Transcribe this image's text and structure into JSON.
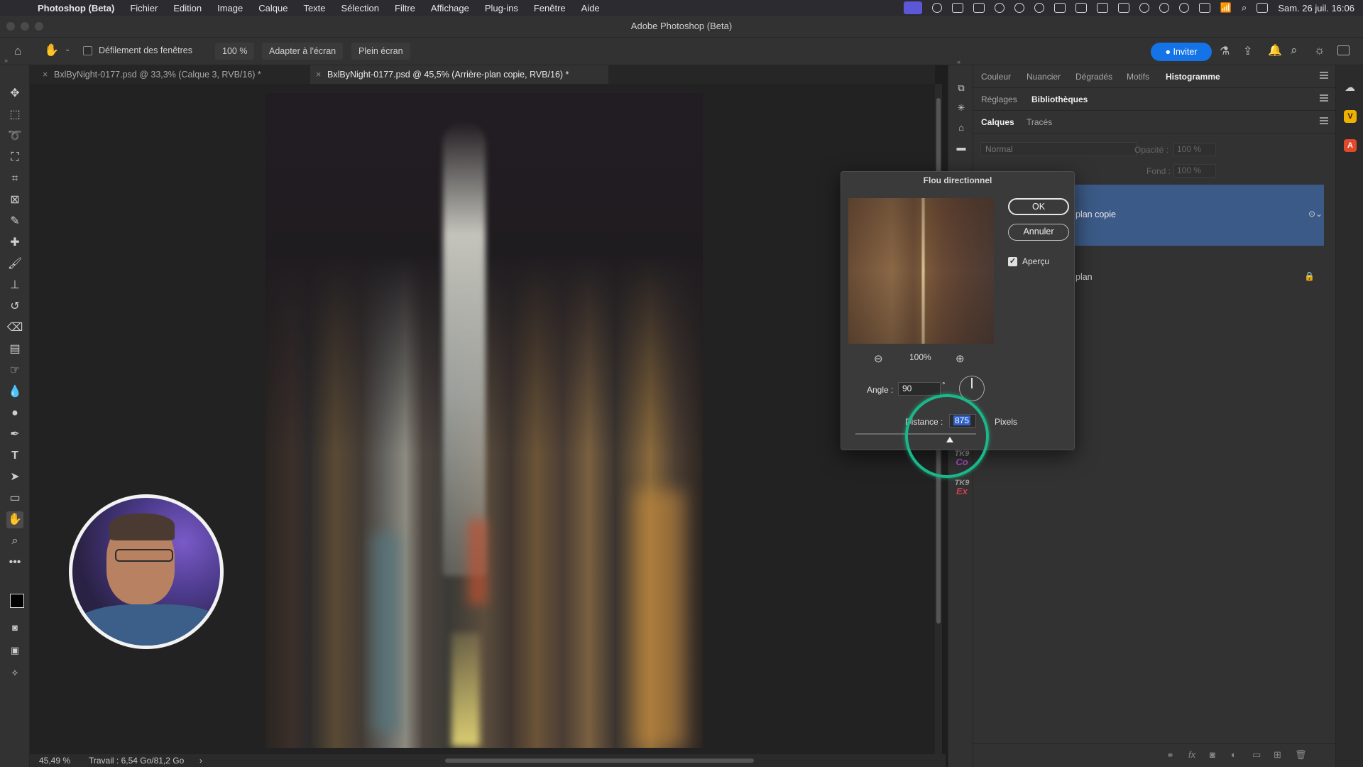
{
  "menubar": {
    "app": "Photoshop (Beta)",
    "items": [
      "Fichier",
      "Edition",
      "Image",
      "Calque",
      "Texte",
      "Sélection",
      "Filtre",
      "Affichage",
      "Plug-ins",
      "Fenêtre",
      "Aide"
    ],
    "clock": "Sam. 26 juil.  16:06"
  },
  "window": {
    "title": "Adobe Photoshop (Beta)"
  },
  "options": {
    "scroll_all_label": "Défilement des fenêtres",
    "zoom_value": "100 %",
    "fit_screen": "Adapter à l'écran",
    "fill_screen": "Plein écran",
    "invite": "Inviter"
  },
  "tabs": [
    {
      "label": "BxlByNight-0177.psd @ 33,3% (Calque 3, RVB/16) *",
      "active": false
    },
    {
      "label": "BxlByNight-0177.psd @ 45,5% (Arrière-plan copie, RVB/16) *",
      "active": true
    }
  ],
  "status": {
    "zoom": "45,49 %",
    "work": "Travail : 6,54 Go/81,2 Go",
    "arrow": "›"
  },
  "panels": {
    "row1": [
      "Couleur",
      "Nuancier",
      "Dégradés",
      "Motifs",
      "Histogramme"
    ],
    "row2": [
      "Réglages",
      "Bibliothèques"
    ],
    "row3": [
      "Calques",
      "Tracés"
    ],
    "blend_mode": "Normal",
    "opacity_label": "Opacité :",
    "opacity_value": "100 %",
    "fill_label": "Fond :",
    "fill_value": "100 %",
    "layers": [
      {
        "name": "plan copie",
        "selected": true
      },
      {
        "name": "plan",
        "selected": false
      }
    ]
  },
  "minicol": {
    "tk1_top": "TK9",
    "tk1_bottom": "Co",
    "tk2_top": "TK9",
    "tk2_bottom": "Ex"
  },
  "dialog": {
    "title": "Flou directionnel",
    "ok": "OK",
    "cancel": "Annuler",
    "preview_label": "Aperçu",
    "preview_checked": true,
    "zoom": "100%",
    "angle_label": "Angle :",
    "angle_value": "90",
    "degree": "°",
    "distance_label": "Distance :",
    "distance_value": "875",
    "unit": "Pixels"
  },
  "colors": {
    "accent": "#1473e6",
    "selection": "#3c5a87",
    "ring": "#1ab78a"
  }
}
